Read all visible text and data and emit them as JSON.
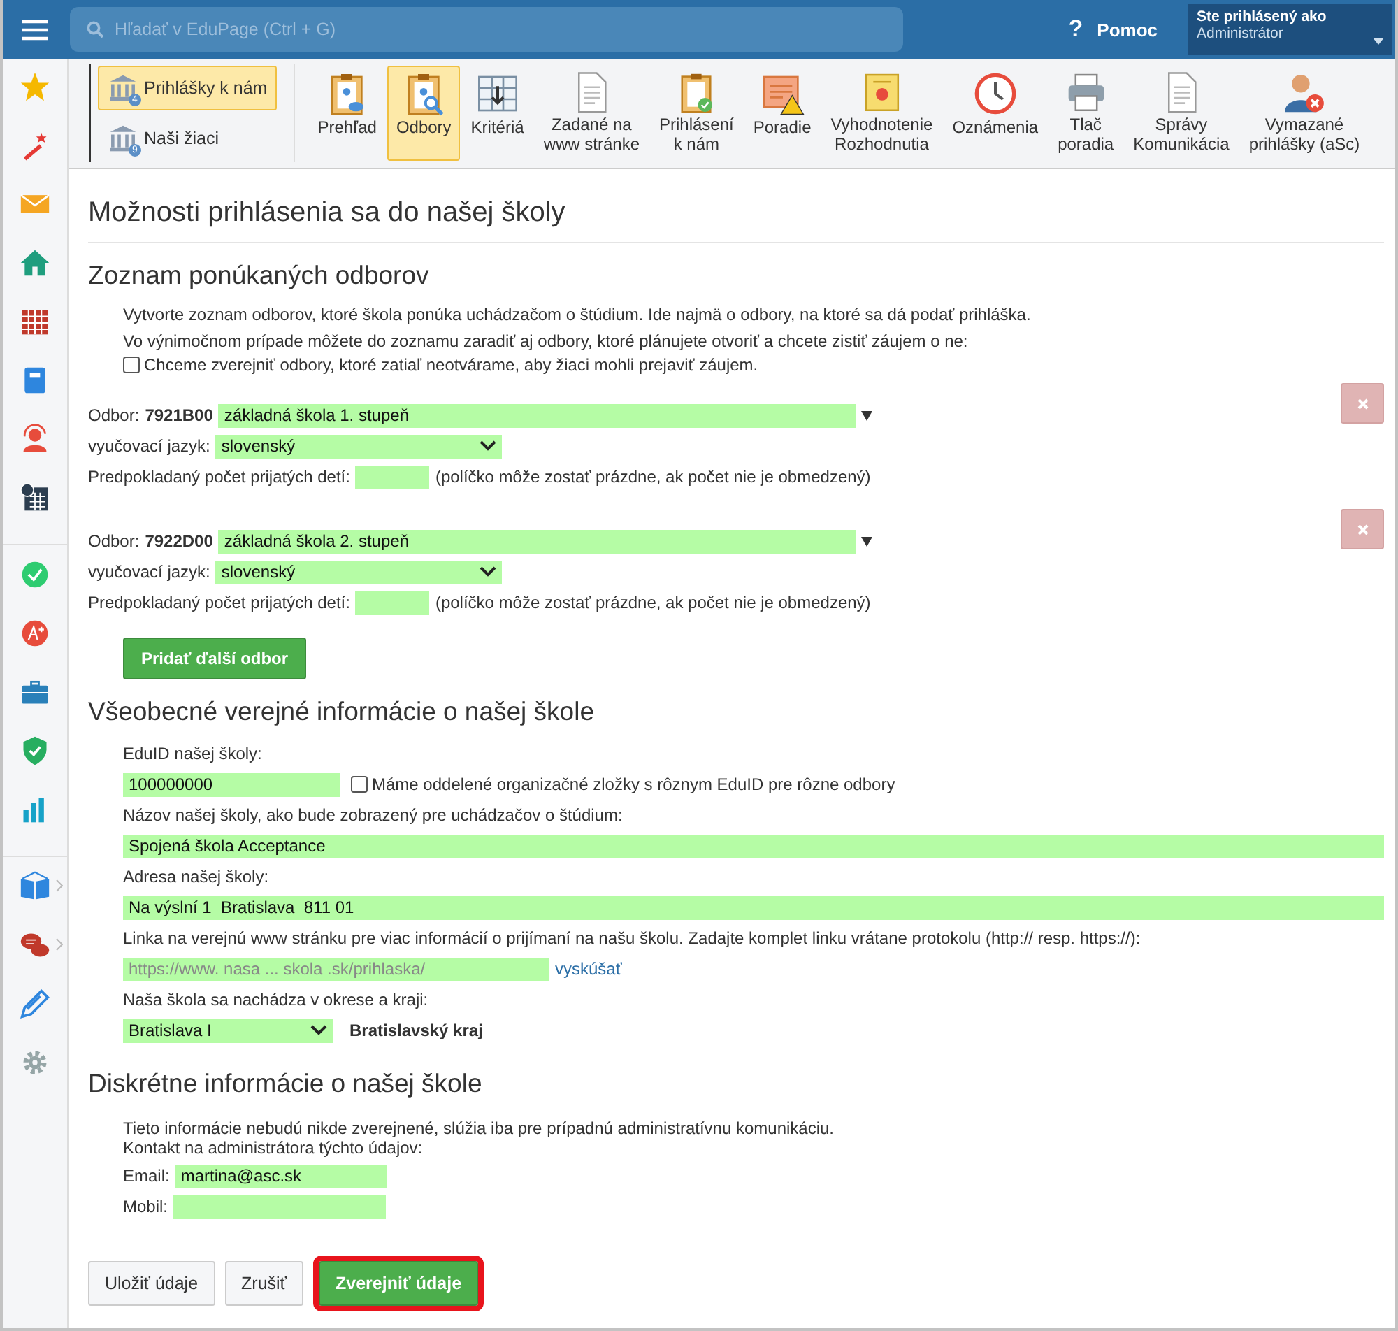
{
  "header": {
    "search_placeholder": "Hľadať v EduPage (Ctrl + G)",
    "help_mark": "?",
    "help": "Pomoc",
    "user_label": "Ste prihlásený ako",
    "user_name": "Administrátor"
  },
  "subnav": [
    {
      "label": "Prihlášky k nám",
      "badge": "4",
      "selected": true
    },
    {
      "label": "Naši žiaci",
      "badge": "9",
      "selected": false
    }
  ],
  "toolbar": [
    {
      "label": "Prehľad",
      "selected": false
    },
    {
      "label": "Odbory",
      "selected": true
    },
    {
      "label": "Kritériá",
      "selected": false
    },
    {
      "label": "Zadané na\nwww stránke",
      "selected": false
    },
    {
      "label": "Prihlásení\nk nám",
      "selected": false
    },
    {
      "label": "Poradie",
      "selected": false
    },
    {
      "label": "Vyhodnotenie\nRozhodnutia",
      "selected": false
    },
    {
      "label": "Oznámenia",
      "selected": false
    },
    {
      "label": "Tlač\nporadia",
      "selected": false
    },
    {
      "label": "Správy\nKomunikácia",
      "selected": false
    },
    {
      "label": "Vymazané\nprihlášky (aSc)",
      "selected": false
    }
  ],
  "page_title": "Možnosti prihlásenia sa do našej školy",
  "programs_section": {
    "title": "Zoznam ponúkaných odborov",
    "intro": [
      "Vytvorte zoznam odborov, ktoré škola ponúka uchádzačom o štúdium. Ide najmä o odbory, na ktoré sa dá podať prihláška.",
      "Vo výnimočnom prípade môžete do zoznamu zaradiť aj odbory, ktoré plánujete otvoriť a chcete zistiť záujem o ne:"
    ],
    "publish_unopened": {
      "label": "Chceme zverejniť odbory, ktoré zatiaľ neotvárame, aby žiaci mohli prejaviť záujem.",
      "checked": false
    },
    "programs": [
      {
        "program_label": "Odbor:",
        "code": "7921B00",
        "name": "základná škola 1. stupeň",
        "language_label": "vyučovací jazyk:",
        "language": "slovenský",
        "count_label": "Predpokladaný počet prijatých detí:",
        "count_hint": "(políčko môže zostať prázdne, ak počet nie je obmedzený)"
      },
      {
        "program_label": "Odbor:",
        "code": "7922D00",
        "name": "základná škola 2. stupeň",
        "language_label": "vyučovací jazyk:",
        "language": "slovenský",
        "count_label": "Predpokladaný počet prijatých detí:",
        "count_hint": "(políčko môže zostať prázdne, ak počet nie je obmedzený)"
      }
    ],
    "add_button": "Pridať ďalší odbor"
  },
  "public_section": {
    "title": "Všeobecné verejné informácie o našej škole",
    "eduid_label": "EduID našej školy:",
    "eduid": "100000000",
    "separate_units": {
      "label": "Máme oddelené organizačné zložky s rôznym EduID pre rôzne odbory",
      "checked": false
    },
    "name_label": "Názov našej školy, ako bude zobrazený pre uchádzačov o štúdium:",
    "name": "Spojená škola Acceptance",
    "address_label": "Adresa našej školy:",
    "address": "Na výslní 1  Bratislava  811 01",
    "link_label": "Linka na verejnú www stránku pre viac informácií o prijímaní na našu školu. Zadajte komplet linku vrátane protokolu (http:// resp. https://):",
    "link_placeholder": "https://www. nasa ... skola .sk/prihlaska/",
    "link_test": "vyskúšať",
    "district_label": "Naša škola sa nachádza v okrese a kraji:",
    "district": "Bratislava I",
    "region": "Bratislavský kraj"
  },
  "private_section": {
    "title": "Diskrétne informácie o našej škole",
    "note": [
      "Tieto informácie nebudú nikde zverejnené, slúžia iba pre prípadnú administratívnu komunikáciu.",
      "Kontakt na administrátora týchto údajov:"
    ],
    "email_label": "Email:",
    "email": "martina@asc.sk",
    "mobile_label": "Mobil:"
  },
  "actions": [
    {
      "label": "Uložiť údaje",
      "kind": "plain",
      "highlighted": false
    },
    {
      "label": "Zrušiť",
      "kind": "plain",
      "highlighted": false
    },
    {
      "label": "Zverejniť údaje",
      "kind": "primary",
      "highlighted": true
    }
  ]
}
